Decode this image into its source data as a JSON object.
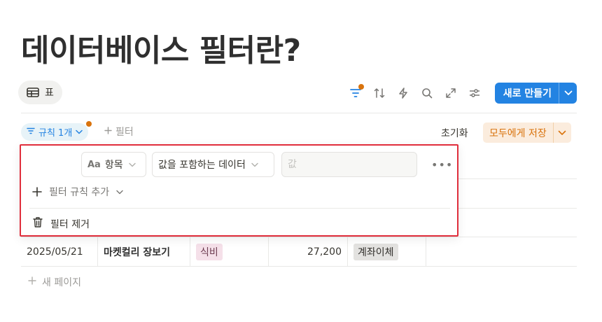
{
  "page": {
    "title": "데이터베이스 필터란?"
  },
  "view_tab": {
    "label": "표",
    "icon": "table-icon"
  },
  "toolbar": {
    "icons": [
      "filter-icon",
      "sort-icon",
      "lightning-icon",
      "search-icon",
      "expand-icon",
      "settings-icon"
    ],
    "new_label": "새로 만들기"
  },
  "filter_bar": {
    "rule_chip": "규칙 1개",
    "add_filter": "필터",
    "reset": "초기화",
    "save": "모두에게 저장"
  },
  "popup": {
    "property": {
      "icon": "text-property-icon",
      "icon_text": "Aa",
      "label": "항목"
    },
    "condition": "값을 포함하는 데이터",
    "value_placeholder": "값",
    "add_rule": "필터 규칙 추가",
    "remove": "필터 제거"
  },
  "table": {
    "rows": [
      {
        "date": "2025/05/21",
        "item": "마켓컬리 장보기",
        "category": "식비",
        "amount": "27,200",
        "payment": "계좌이체"
      }
    ],
    "new_page": "새 페이지"
  },
  "colors": {
    "accent": "#2383e2",
    "dot": "#d9730d",
    "highlight_border": "#e02e3c",
    "save_bg": "#fbecdd",
    "save_text": "#d9730d"
  }
}
